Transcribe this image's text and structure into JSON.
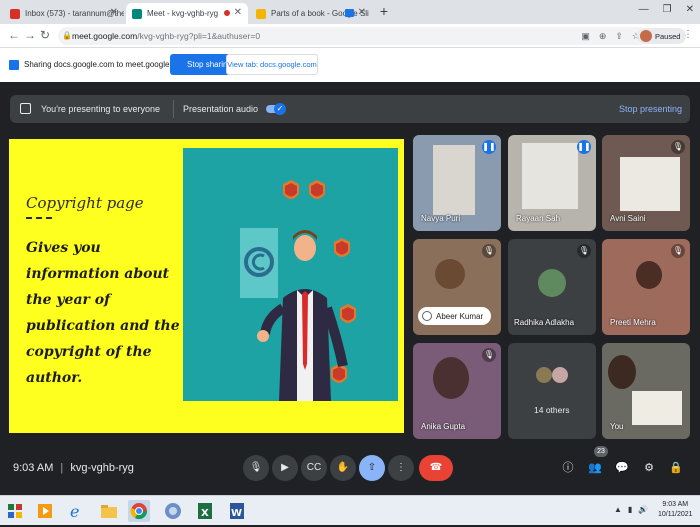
{
  "browser": {
    "tabs": [
      {
        "title": "Inbox (573) - tarannum@theindi",
        "favicon_color": "#d93025",
        "active": false
      },
      {
        "title": "Meet - kvg-vghb-ryg",
        "favicon_color": "#00897b",
        "active": true
      },
      {
        "title": "Parts of a book - Google Sli",
        "favicon_color": "#f4b400",
        "active": false
      }
    ],
    "new_tab_label": "+",
    "url_host": "meet.google.com",
    "url_path": "/kvg-vghb-ryg?pli=1&authuser=0",
    "profile_label": "Paused"
  },
  "sharebar": {
    "sharing_text": "Sharing docs.google.com to meet.google.com",
    "stop_label": "Stop sharing",
    "view_label": "View tab: docs.google.com"
  },
  "presenting": {
    "message": "You're presenting to everyone",
    "audio_label": "Presentation audio",
    "stop_label": "Stop presenting"
  },
  "slide": {
    "title": "Copyright page",
    "body": "Gives you\ninformation about\nthe year of\npublication and the\ncopyright of the\nauthor."
  },
  "participants": [
    {
      "name": "Navya Puri",
      "mic": "active",
      "bg": "#8a9bb0"
    },
    {
      "name": "Rayaan Sah",
      "mic": "active",
      "bg": "#b7b4ad"
    },
    {
      "name": "Avni Saini",
      "mic": "muted",
      "bg": "#6e5a52"
    },
    {
      "name": "Abeer Kumar",
      "mic": "muted",
      "bg": "#8a6f5a"
    },
    {
      "name": "Radhika Adlakha",
      "mic": "muted",
      "bg": "#3c4043"
    },
    {
      "name": "Preeti Mehra",
      "mic": "muted",
      "bg": "#9e6a5c"
    },
    {
      "name": "Anika Gupta",
      "mic": "muted",
      "bg": "#7a5c78"
    },
    {
      "name": "14 others",
      "mic": "none",
      "bg": "#3c4043"
    },
    {
      "name": "You",
      "mic": "none",
      "bg": "#6b6a62"
    }
  ],
  "bottombar": {
    "time": "9:03 AM",
    "separator": "|",
    "meeting_code": "kvg-vghb-ryg",
    "people_count": "23"
  },
  "taskbar": {
    "time": "9:03 AM",
    "date": "10/11/2021"
  },
  "colors": {
    "slide_bg": "#ffff1f",
    "illustration_bg": "#1da3a3",
    "leave": "#ea4335",
    "accent": "#1a73e8"
  }
}
